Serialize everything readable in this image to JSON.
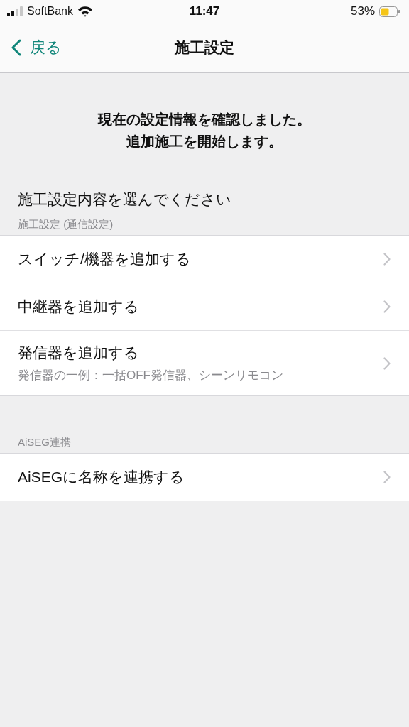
{
  "status_bar": {
    "carrier": "SoftBank",
    "time": "11:47",
    "battery": "53%"
  },
  "nav": {
    "back": "戻る",
    "title": "施工設定"
  },
  "message": [
    "現在の設定情報を確認しました。",
    "追加施工を開始します。"
  ],
  "prompt": "施工設定内容を選んでください",
  "sections": [
    {
      "header": "施工設定 (通信設定)",
      "rows": [
        {
          "label": "スイッチ/機器を追加する"
        },
        {
          "label": "中継器を追加する"
        },
        {
          "label": "発信器を追加する",
          "subtitle": "発信器の一例：一括OFF発信器、シーンリモコン"
        }
      ]
    },
    {
      "header": "AiSEG連携",
      "rows": [
        {
          "label": "AiSEGに名称を連携する"
        }
      ]
    }
  ]
}
